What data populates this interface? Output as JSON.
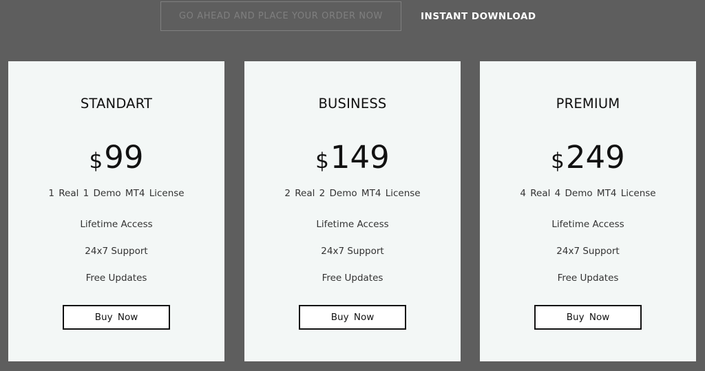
{
  "header": {
    "order_button_label": "GO AHEAD AND PLACE YOUR ORDER NOW",
    "instant_label": "INSTANT DOWNLOAD"
  },
  "plans": [
    {
      "name": "STANDART",
      "currency": "$",
      "price": "99",
      "license": "1 Real 1 Demo MT4 License",
      "features": [
        "Lifetime Access",
        "24x7 Support",
        "Free Updates"
      ],
      "button_label": "Buy Now"
    },
    {
      "name": "BUSINESS",
      "currency": "$",
      "price": "149",
      "license": "2 Real 2 Demo MT4 License",
      "features": [
        "Lifetime Access",
        "24x7 Support",
        "Free Updates"
      ],
      "button_label": "Buy Now"
    },
    {
      "name": "PREMIUM",
      "currency": "$",
      "price": "249",
      "license": "4 Real 4 Demo MT4 License",
      "features": [
        "Lifetime Access",
        "24x7 Support",
        "Free Updates"
      ],
      "button_label": "Buy Now"
    }
  ],
  "colors": {
    "background": "#5e5e5e",
    "card_background": "#f3f7f6",
    "text_dark": "#111111",
    "order_button_border": "#808080",
    "instant_label": "#ffffff"
  }
}
